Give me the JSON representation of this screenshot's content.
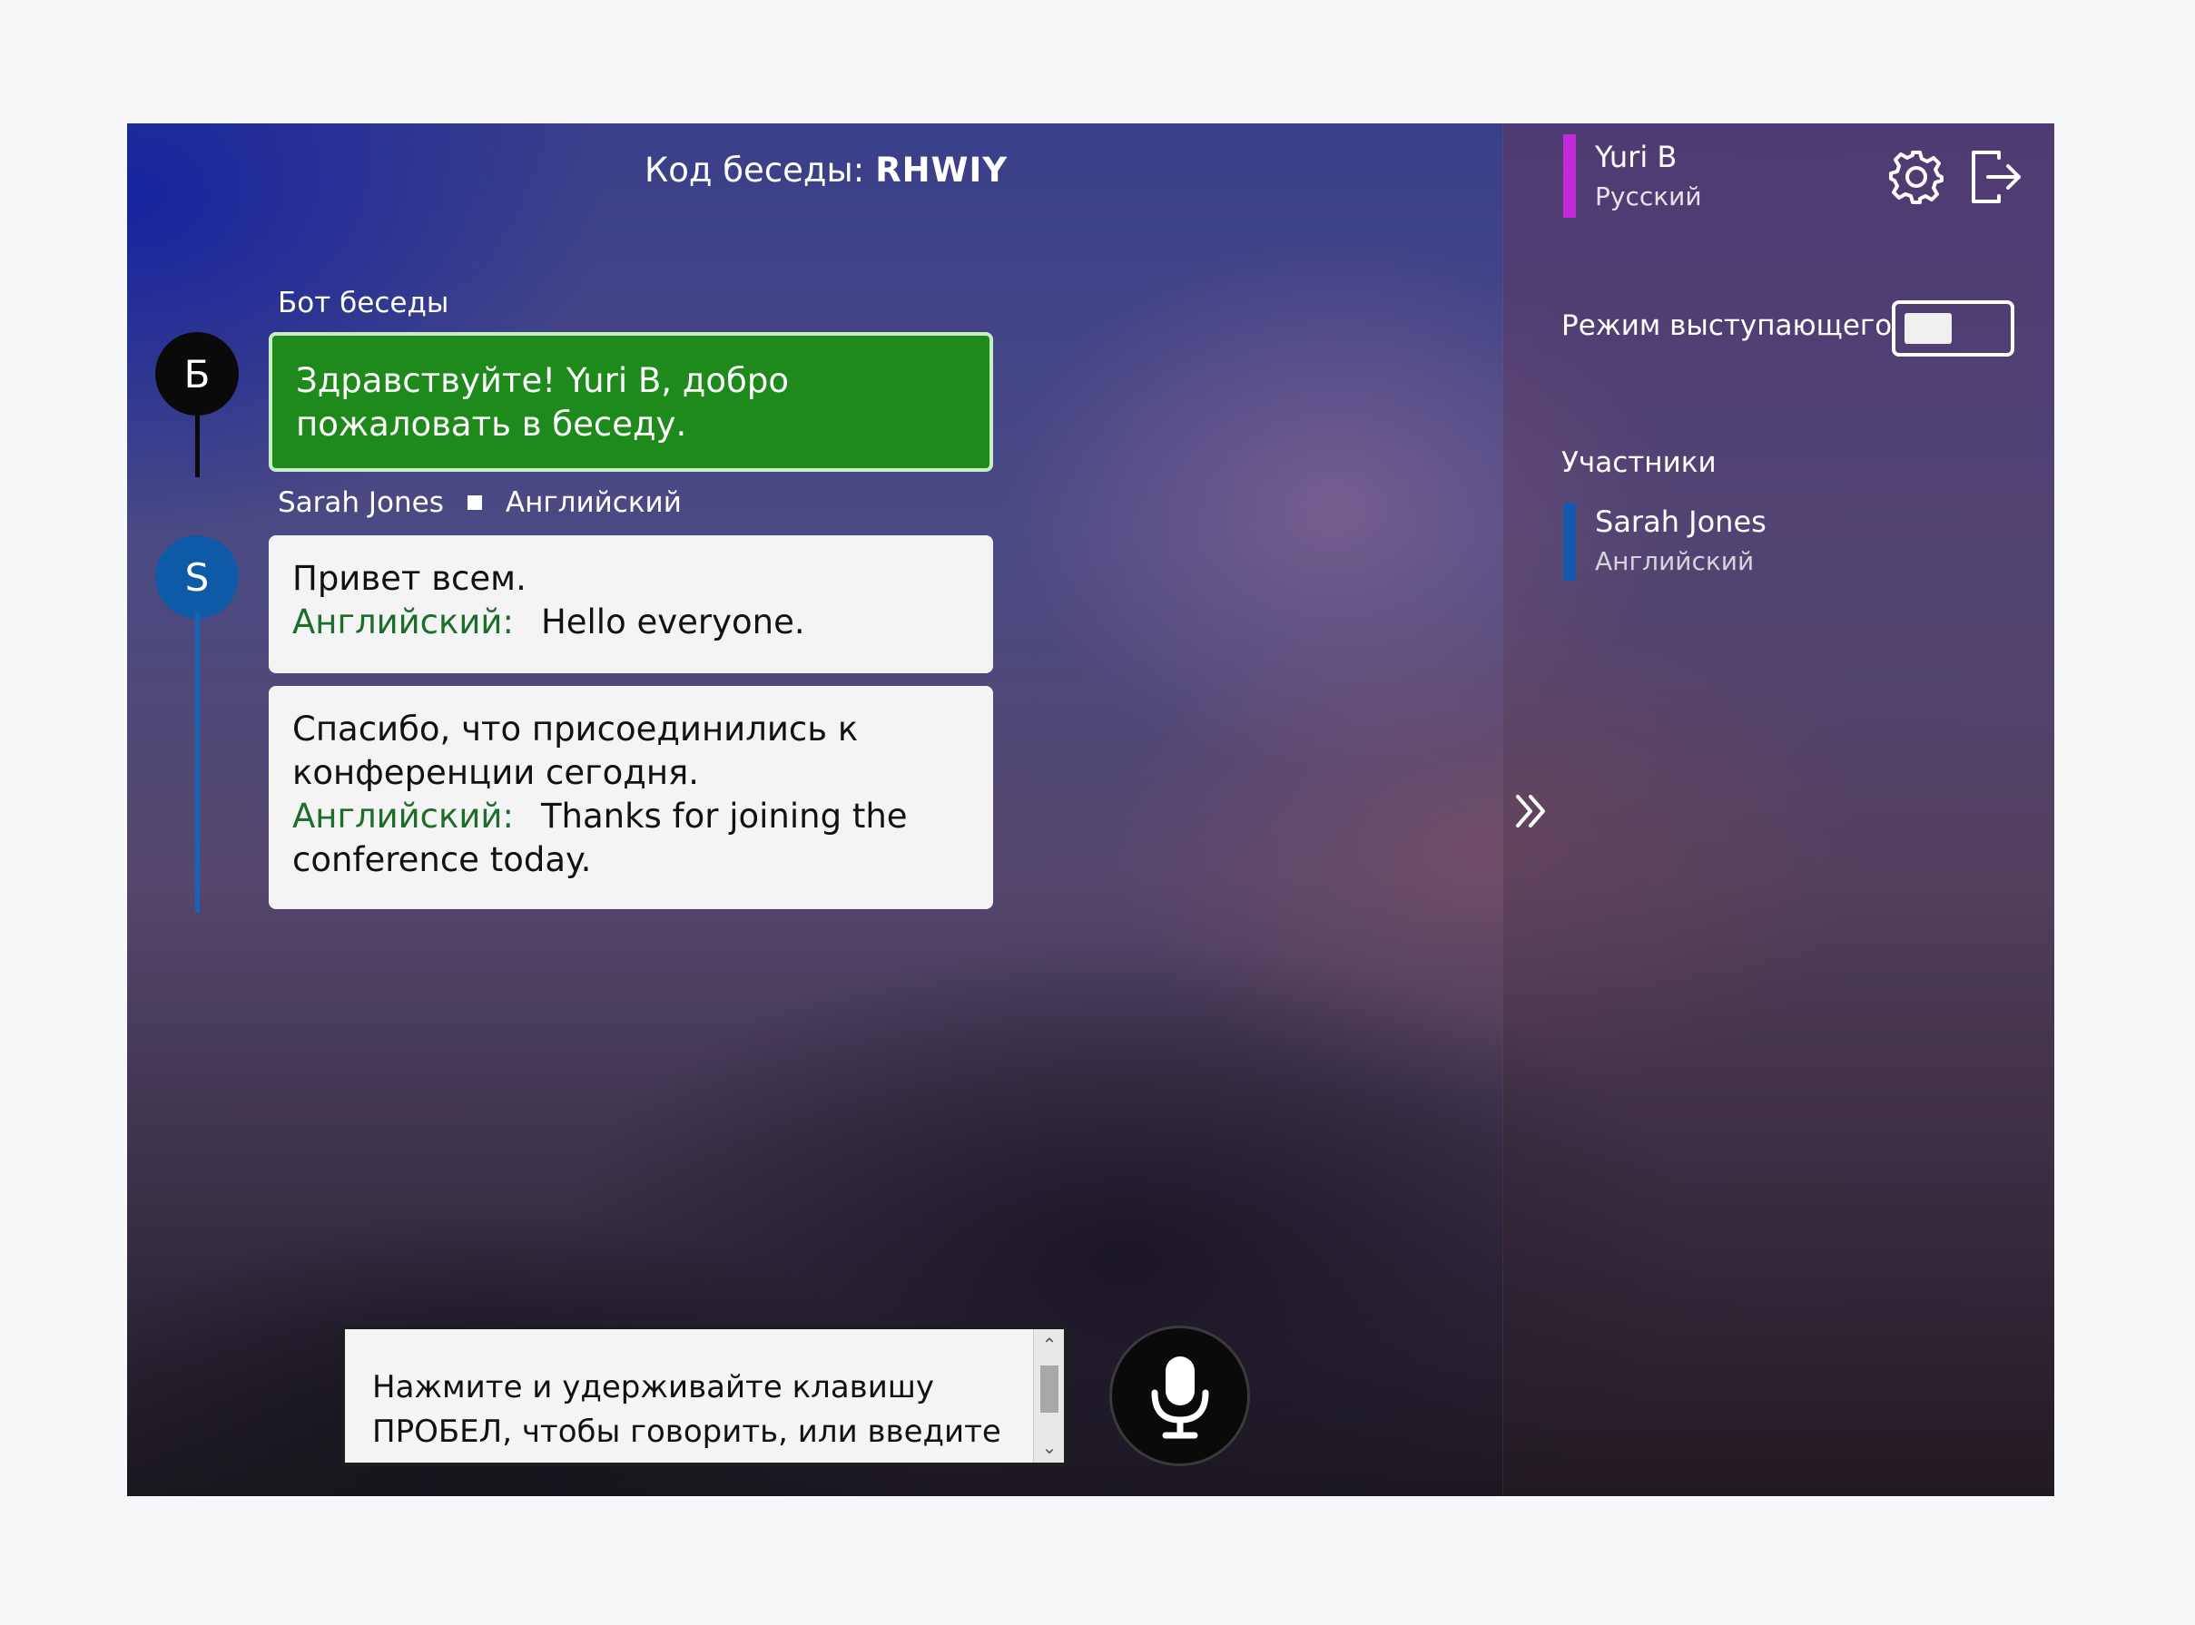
{
  "header": {
    "title_label": "Код беседы:",
    "code": "RHWIY"
  },
  "messages": [
    {
      "speaker": "Бот беседы",
      "avatar_letter": "Б",
      "text": "Здравствуйте! Yuri B, добро пожаловать в беседу."
    },
    {
      "speaker": "Sarah Jones",
      "speaker_language": "Английский",
      "avatar_letter": "S",
      "items": [
        {
          "original": "Привет всем.",
          "translation_label": "Английский:",
          "translation": "Hello everyone."
        },
        {
          "original": "Спасибо, что присоединились к конференции сегодня.",
          "translation_label": "Английский:",
          "translation": "Thanks for joining the conference today."
        }
      ]
    }
  ],
  "input": {
    "placeholder": "Нажмите и удерживайте клавишу ПРОБЕЛ, чтобы говорить, или введите"
  },
  "sidebar": {
    "user_name": "Yuri B",
    "user_language": "Русский",
    "presenter_mode_label": "Режим выступающего",
    "presenter_mode_on": false,
    "participants_title": "Участники",
    "participants": [
      {
        "name": "Sarah Jones",
        "language": "Английский"
      }
    ]
  },
  "colors": {
    "bot_bubble": "#1e8a1b",
    "user_accent": "#c02ad8",
    "participant_accent": "#1658ad",
    "translation_label": "#1d6e2a"
  },
  "icons": [
    "gear-icon",
    "exit-icon",
    "collapse-chevron-icon",
    "microphone-icon"
  ]
}
